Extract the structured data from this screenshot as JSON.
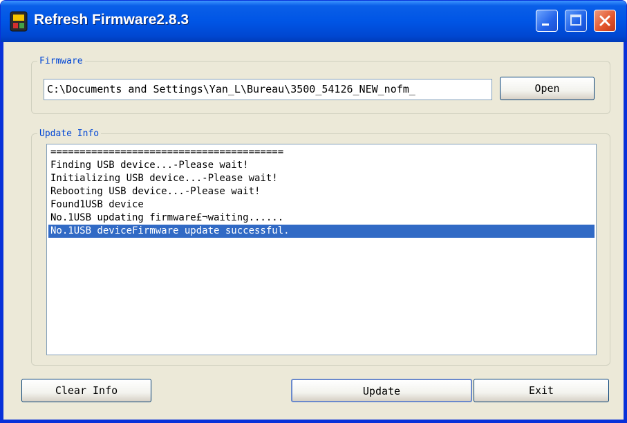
{
  "window": {
    "title": "Refresh Firmware2.8.3"
  },
  "firmware_group": {
    "legend": "Firmware",
    "path_value": "C:\\Documents and Settings\\Yan_L\\Bureau\\3500_54126_NEW_nofm_",
    "open_label": "Open"
  },
  "update_info_group": {
    "legend": "Update Info",
    "lines": [
      "========================================",
      "Finding USB device...-Please wait!",
      "Initializing USB device...-Please wait!",
      "Rebooting USB device...-Please wait!",
      "Found1USB device",
      "No.1USB updating firmware£¬waiting......",
      "No.1USB deviceFirmware update successful."
    ],
    "selected_index": 6
  },
  "buttons": {
    "clear_label": "Clear Info",
    "update_label": "Update",
    "exit_label": "Exit"
  },
  "colors": {
    "titlebar": "#0055e5",
    "selection": "#316ac5",
    "legend_text": "#0046d5",
    "close_button": "#e2542b"
  },
  "icons": {
    "app": "mp3-player-icon",
    "minimize": "minimize-icon",
    "maximize": "maximize-icon",
    "close": "close-icon"
  }
}
